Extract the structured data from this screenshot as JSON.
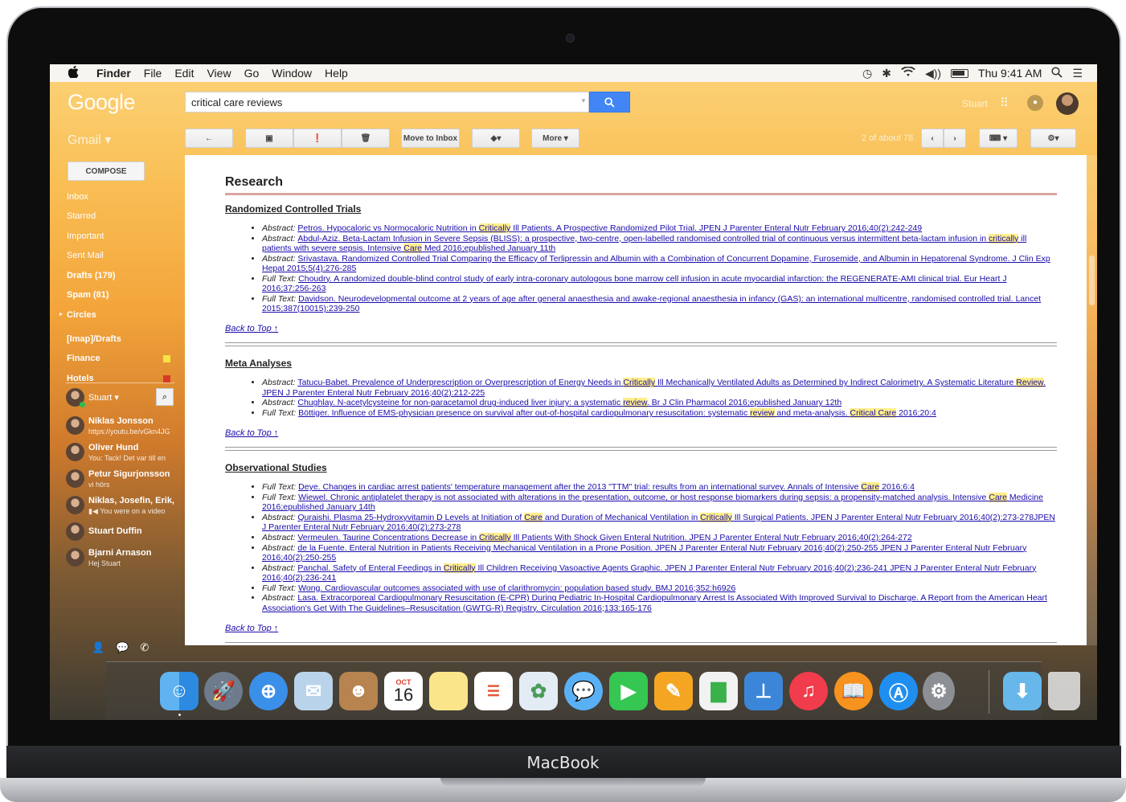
{
  "menubar": {
    "apple": "",
    "app": "Finder",
    "items": [
      "File",
      "Edit",
      "View",
      "Go",
      "Window",
      "Help"
    ],
    "clock": "Thu 9:41 AM"
  },
  "gmail": {
    "logo": "Google",
    "label": "Gmail ▾",
    "search_value": "critical care reviews",
    "user": "Stuart",
    "toolbar": {
      "move_to_inbox": "Move to Inbox",
      "more": "More ▾",
      "pager": "2 of about 78"
    },
    "compose": "COMPOSE",
    "nav": [
      "Inbox",
      "Starred",
      "Important",
      "Sent Mail",
      "Drafts (179)",
      "Spam (81)",
      "Circles",
      "[Imap]/Drafts",
      "Finance",
      "Hotels"
    ],
    "chat_user": "Stuart ▾",
    "contacts": [
      {
        "name": "Niklas Jonsson",
        "sub": "https://youtu.be/vGkn4JG"
      },
      {
        "name": "Oliver Hund",
        "sub": "You: Tack! Det var till en"
      },
      {
        "name": "Petur Sigurjonsson",
        "sub": "vi hörs"
      },
      {
        "name": "Niklas, Josefin, Erik,",
        "sub": "▮◀ You were on a video"
      },
      {
        "name": "Stuart Duffin",
        "sub": ""
      },
      {
        "name": "Bjarni Arnason",
        "sub": "Hej Stuart"
      }
    ]
  },
  "email": {
    "heading": "Research",
    "back_to_top": "Back to Top ↑",
    "sections": [
      {
        "title": "Randomized Controlled Trials",
        "items": [
          {
            "kind": "Abstract:",
            "parts": [
              "Petros. Hypocaloric vs Normocaloric Nutrition in ",
              "Critically",
              " Ill Patients. A Prospective Randomized Pilot Trial. JPEN J Parenter Enteral Nutr February 2016;40(2):242-249"
            ]
          },
          {
            "kind": "Abstract:",
            "parts": [
              "Abdul-Aziz. Beta-Lactam Infusion in Severe Sepsis (BLISS): a prospective, two-centre, open-labelled randomised controlled trial of continuous versus intermittent beta-lactam infusion in ",
              "critically",
              " ill patients with severe sepsis. Intensive ",
              "Care",
              " Med 2016;epublished January 11th"
            ]
          },
          {
            "kind": "Abstract:",
            "parts": [
              "Srivastava. Randomized Controlled Trial Comparing the Efficacy of Terlipressin and Albumin with a Combination of Concurrent Dopamine, Furosemide, and Albumin in Hepatorenal Syndrome. J Clin Exp Hepat 2015;5(4):276-285"
            ]
          },
          {
            "kind": "Full Text:",
            "parts": [
              "Choudry. A randomized double-blind control study of early intra-coronary autologous bone marrow cell infusion in acute myocardial infarction: the REGENERATE-AMI clinical trial. Eur Heart J 2016;37:256-263"
            ]
          },
          {
            "kind": "Full Text:",
            "parts": [
              "Davidson. Neurodevelopmental outcome at 2 years of age after general anaesthesia and awake-regional anaesthesia in infancy (GAS): an international multicentre, randomised controlled trial. Lancet 2015;387(10015):239-250"
            ]
          }
        ]
      },
      {
        "title": "Meta Analyses",
        "items": [
          {
            "kind": "Abstract:",
            "parts": [
              "Tatucu-Babet. Prevalence of Underprescription or Overprescription of Energy Needs in ",
              "Critically",
              " Ill Mechanically Ventilated Adults as Determined by Indirect Calorimetry. A Systematic Literature ",
              "Review",
              ". JPEN J Parenter Enteral Nutr February 2016;40(2):212-225"
            ]
          },
          {
            "kind": "Abstract:",
            "parts": [
              "Chughlay. N-acetylcysteine for non-paracetamol drug-induced liver injury: a systematic ",
              "review",
              ". Br J Clin Pharmacol 2016;epublished January 12th"
            ]
          },
          {
            "kind": "Full Text:",
            "parts": [
              "Böttiger. Influence of EMS-physician presence on survival after out-of-hospital cardiopulmonary resuscitation: systematic ",
              "review",
              " and meta-analysis. ",
              "Critical Care",
              " 2016;20:4"
            ]
          }
        ]
      },
      {
        "title": "Observational Studies",
        "items": [
          {
            "kind": "Full Text:",
            "parts": [
              "Deye. Changes in cardiac arrest patients' temperature management after the 2013 \"TTM\" trial: results from an international survey. Annals of Intensive ",
              "Care",
              " 2016;6:4"
            ]
          },
          {
            "kind": "Full Text:",
            "parts": [
              "Wiewel. Chronic antiplatelet therapy is not associated with alterations in the presentation, outcome, or host response biomarkers during sepsis: a propensity-matched analysis. Intensive ",
              "Care",
              " Medicine 2016;epublished January 14th"
            ]
          },
          {
            "kind": "Abstract:",
            "parts": [
              "Quraishi. Plasma 25-Hydroxyvitamin D Levels at Initiation of ",
              "Care",
              " and Duration of Mechanical Ventilation in ",
              "Critically",
              " Ill Surgical Patients. JPEN J Parenter Enteral Nutr February 2016;40(2):273-278JPEN J Parenter Enteral Nutr February 2016;40(2):273-278"
            ]
          },
          {
            "kind": "Abstract:",
            "parts": [
              "Vermeulen. Taurine Concentrations Decrease in ",
              "Critically",
              " Ill Patients With Shock Given Enteral Nutrition. JPEN J Parenter Enteral Nutr February 2016;40(2):264-272"
            ]
          },
          {
            "kind": "Abstract:",
            "parts": [
              "de la Fuente. Enteral Nutrition in Patients Receiving Mechanical Ventilation in a Prone Position. JPEN J Parenter Enteral Nutr February 2016;40(2):250-255 JPEN J Parenter Enteral Nutr February 2016;40(2):250-255"
            ]
          },
          {
            "kind": "Abstract:",
            "parts": [
              "Panchal. Safety of Enteral Feedings in ",
              "Critically",
              " Ill Children Receiving Vasoactive Agents Graphic. JPEN J Parenter Enteral Nutr February 2016;40(2):236-241 JPEN J Parenter Enteral Nutr February 2016;40(2):236-241"
            ]
          },
          {
            "kind": "Full Text:",
            "parts": [
              "Wong. Cardiovascular outcomes associated with use of clarithromycin: population based study. BMJ 2016;352:h6926"
            ]
          },
          {
            "kind": "Abstract:",
            "parts": [
              "Lasa. Extracorporeal Cardiopulmonary Resuscitation (E-CPR) During Pediatric In-Hospital Cardiopulmonary Arrest Is Associated With Improved Survival to Discharge. A Report from the American Heart Association's Get With The Guidelines–Resuscitation (GWTG-R) Registry. Circulation 2016;133:165-176"
            ]
          }
        ]
      }
    ]
  },
  "dock": {
    "calendar_month": "OCT",
    "calendar_day": "16",
    "apps": [
      "finder-icon",
      "launchpad-icon",
      "safari-icon",
      "mail-icon",
      "contacts-icon",
      "calendar-icon",
      "notes-icon",
      "reminders-icon",
      "photos-icon",
      "messages-icon",
      "facetime-icon",
      "pages-icon",
      "numbers-icon",
      "keynote-icon",
      "itunes-icon",
      "ibooks-icon",
      "app-store-icon",
      "system-preferences-icon",
      "downloads-folder-icon",
      "trash-icon"
    ]
  },
  "device_label": "MacBook",
  "colors": {
    "link": "#1a0dab",
    "highlight": "#ffef8a",
    "search_button": "#4285f4"
  }
}
